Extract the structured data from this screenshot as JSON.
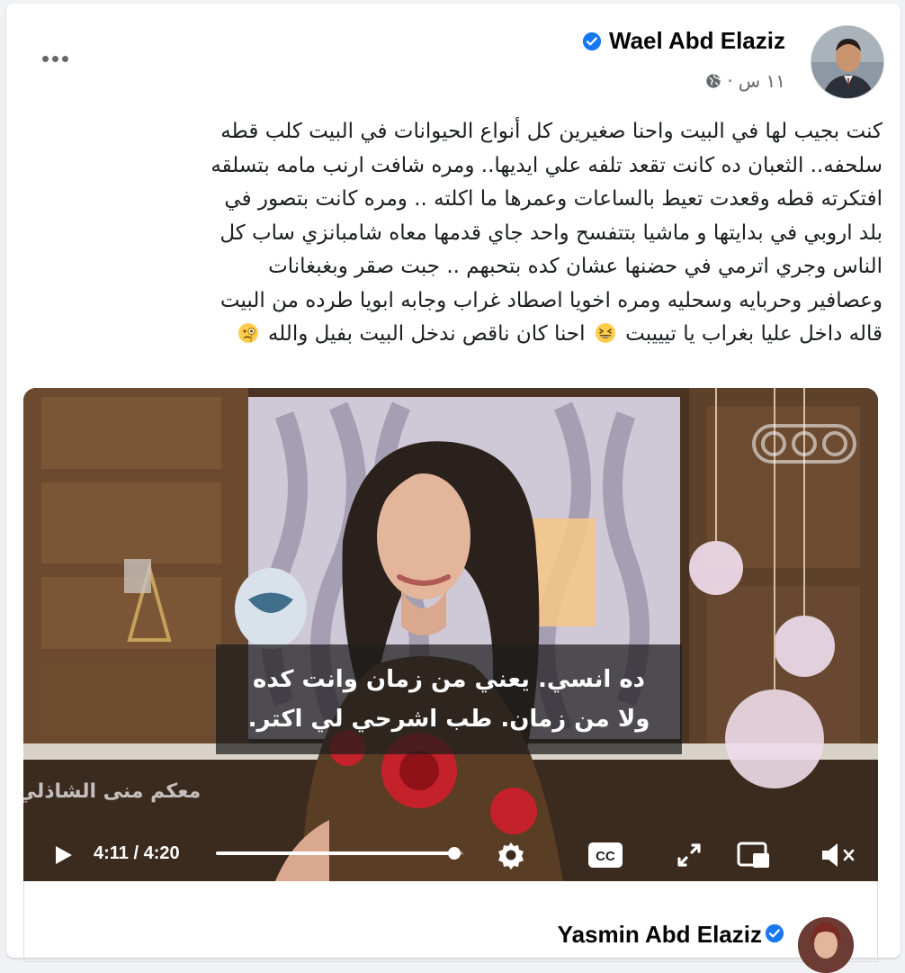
{
  "author": {
    "name": "Wael Abd Elaziz",
    "verified": true
  },
  "post_meta": {
    "time": "١١ س",
    "separator": "·",
    "audience_icon": "globe-icon"
  },
  "post_lines": [
    "كنت بجيب لها في البيت واحنا صغيرين كل أنواع الحيوانات في البيت كلب قطه",
    "سلحفه.. الثعبان ده كانت تقعد تلفه علي ايديها.. ومره شافت ارنب مامه بتسلقه",
    "افتكرته قطه وقعدت تعيط بالساعات وعمرها ما اكلته .. ومره كانت بتصور في",
    "بلد اروبي في بدايتها و ماشيا بتتفسح واحد جاي قدمها معاه شامبانزي ساب كل",
    "الناس وجري اترمي في حضنها عشان كده بتحبهم .. جبت صقر وبغبغانات",
    "وعصافير وحربايه وسحليه ومره اخويا اصطاد غراب وجابه ابويا طرده من البيت"
  ],
  "post_last_line": {
    "part1": "قاله داخل عليا بغراب يا تيييبت",
    "part2": "احنا كان ناقص ندخل البيت بفيل والله",
    "emoji1": "grinning-squinting-face",
    "emoji2": "face-with-monocle"
  },
  "video": {
    "watermark": "CBC",
    "show_logo": "معكم منى الشاذلي",
    "subtitle_line1": "ده انسي. يعني من زمان وانت كده",
    "subtitle_line2": "ولا من زمان. طب اشرحي لي اكتر.",
    "time_current": "4:11",
    "time_total": "4:20",
    "time_display": "4:11 / 4:20",
    "progress_fraction": 0.965,
    "cc_label": "CC"
  },
  "shared_post": {
    "name": "Yasmin Abd Elaziz",
    "verified": true
  },
  "colors": {
    "verified_blue": "#1877f2",
    "muted_text": "#65676b",
    "text": "#1c1e21"
  }
}
